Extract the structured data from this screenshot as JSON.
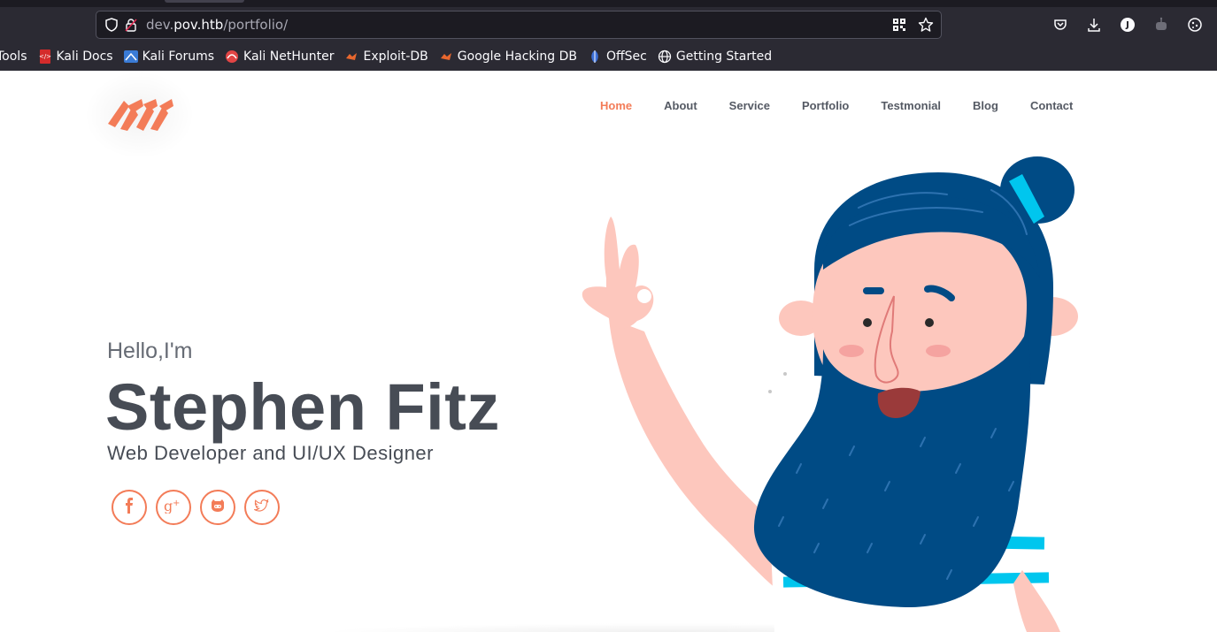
{
  "browser": {
    "url_prefix": "dev.",
    "url_host": "pov.htb",
    "url_path": "/portfolio/",
    "profile_initial": "J",
    "bookmarks": [
      {
        "label": "Tools"
      },
      {
        "label": "Kali Docs"
      },
      {
        "label": "Kali Forums"
      },
      {
        "label": "Kali NetHunter"
      },
      {
        "label": "Exploit-DB"
      },
      {
        "label": "Google Hacking DB"
      },
      {
        "label": "OffSec"
      },
      {
        "label": "Getting Started"
      }
    ]
  },
  "nav": {
    "items": [
      {
        "label": "Home",
        "active": true
      },
      {
        "label": "About"
      },
      {
        "label": "Service"
      },
      {
        "label": "Portfolio"
      },
      {
        "label": "Testmonial"
      },
      {
        "label": "Blog"
      },
      {
        "label": "Contact"
      }
    ]
  },
  "hero": {
    "greeting": "Hello,I'm",
    "name": "Stephen Fitz",
    "role": "Web Developer and UI/UX Designer"
  },
  "socials": [
    {
      "icon": "facebook-icon"
    },
    {
      "icon": "google-plus-icon"
    },
    {
      "icon": "github-icon"
    },
    {
      "icon": "twitter-icon"
    }
  ],
  "colors": {
    "accent": "#f37c58",
    "text_dark": "#474c55",
    "hair": "#004b85",
    "skin": "#fdc7bd"
  }
}
